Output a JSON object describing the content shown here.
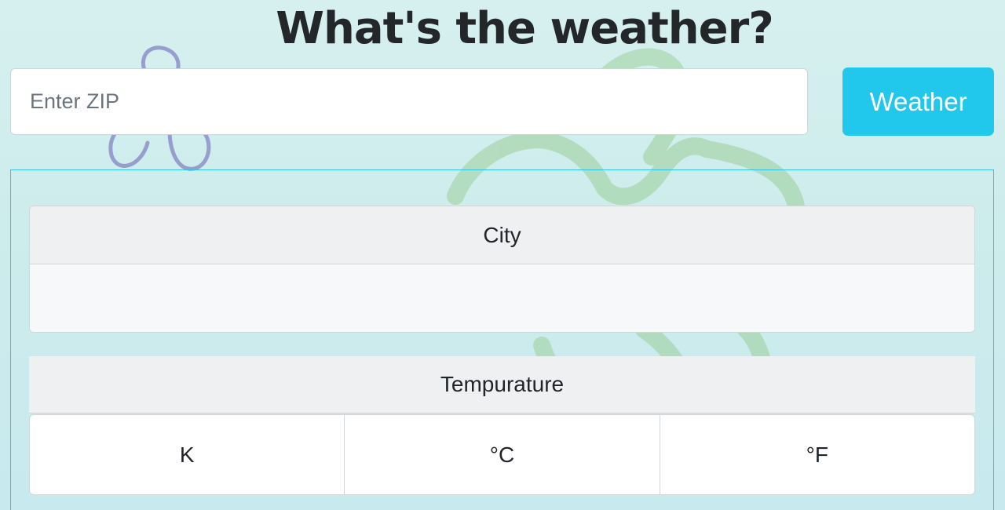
{
  "header": {
    "title": "What's the weather?"
  },
  "search": {
    "placeholder": "Enter ZIP",
    "value": "",
    "button_label": "Weather"
  },
  "results": {
    "city": {
      "label": "City",
      "value": ""
    },
    "temperature": {
      "label": "Tempurature",
      "units": [
        "K",
        "°C",
        "°F"
      ]
    }
  },
  "colors": {
    "accent": "#22c8ec",
    "panel_border": "#2fc3e4",
    "card_header": "#eff0f2",
    "background": "#d6f0ef"
  },
  "icons": [
    "flower-decoration-icon"
  ]
}
